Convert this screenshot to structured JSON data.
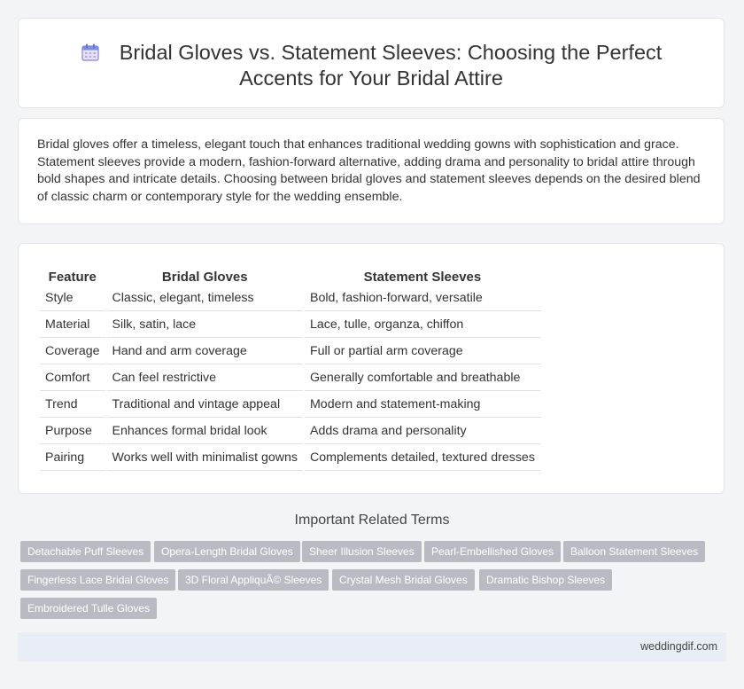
{
  "header": {
    "title_line1": "Bridal Gloves vs. Statement Sleeves: Choosing the Perfect",
    "title_line2": "Accents for Your Bridal Attire",
    "icon": "calendar-icon"
  },
  "intro": {
    "text": "Bridal gloves offer a timeless, elegant touch that enhances traditional wedding gowns with sophistication and grace. Statement sleeves provide a modern, fashion-forward alternative, adding drama and personality to bridal attire through bold shapes and intricate details. Choosing between bridal gloves and statement sleeves depends on the desired blend of classic charm or contemporary style for the wedding ensemble."
  },
  "table": {
    "headers": [
      "Feature",
      "Bridal Gloves",
      "Statement Sleeves"
    ],
    "rows": [
      [
        "Style",
        "Classic, elegant, timeless",
        "Bold, fashion-forward, versatile"
      ],
      [
        "Material",
        "Silk, satin, lace",
        "Lace, tulle, organza, chiffon"
      ],
      [
        "Coverage",
        "Hand and arm coverage",
        "Full or partial arm coverage"
      ],
      [
        "Comfort",
        "Can feel restrictive",
        "Generally comfortable and breathable"
      ],
      [
        "Trend",
        "Traditional and vintage appeal",
        "Modern and statement-making"
      ],
      [
        "Purpose",
        "Enhances formal bridal look",
        "Adds drama and personality"
      ],
      [
        "Pairing",
        "Works well with minimalist gowns",
        "Complements detailed, textured dresses"
      ]
    ]
  },
  "related": {
    "title": "Important Related Terms",
    "tags": [
      "Detachable Puff Sleeves",
      "Opera-Length Bridal Gloves",
      "Sheer Illusion Sleeves",
      "Pearl-Embellished Gloves",
      "Balloon Statement Sleeves",
      "Fingerless Lace Bridal Gloves",
      "3D Floral AppliquÃ© Sleeves",
      "Crystal Mesh Bridal Gloves",
      "Dramatic Bishop Sleeves",
      "Embroidered Tulle Gloves"
    ]
  },
  "footer": {
    "site": "weddingdif.com"
  }
}
